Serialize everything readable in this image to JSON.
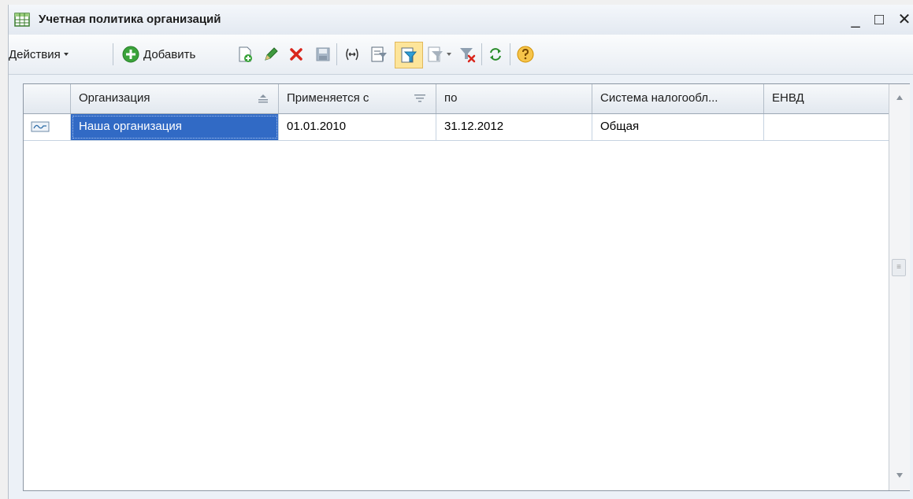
{
  "window": {
    "title": "Учетная политика организаций",
    "minimize_glyph": "_",
    "maximize_glyph": "□",
    "close_glyph": "✕"
  },
  "toolbar": {
    "actions_label": "Действия",
    "add_label": "Добавить",
    "icons": [
      "copy-icon",
      "edit-icon",
      "delete-icon",
      "save-icon",
      "change-position-icon",
      "filter-settings-icon",
      "filter-icon",
      "filter-dropdown-icon",
      "clear-filter-icon",
      "refresh-icon",
      "help-icon"
    ]
  },
  "table": {
    "columns": [
      "Организация",
      "Применяется с",
      "по",
      "Система налогообл...",
      "ЕНВД"
    ],
    "rows": [
      {
        "organization": "Наша организация",
        "from": "01.01.2010",
        "to": "31.12.2012",
        "tax_system": "Общая",
        "envd": ""
      }
    ]
  },
  "colors": {
    "selection": "#316ac5",
    "delete": "#d9261c",
    "add": "#3aa33a",
    "help": "#f0a500"
  }
}
